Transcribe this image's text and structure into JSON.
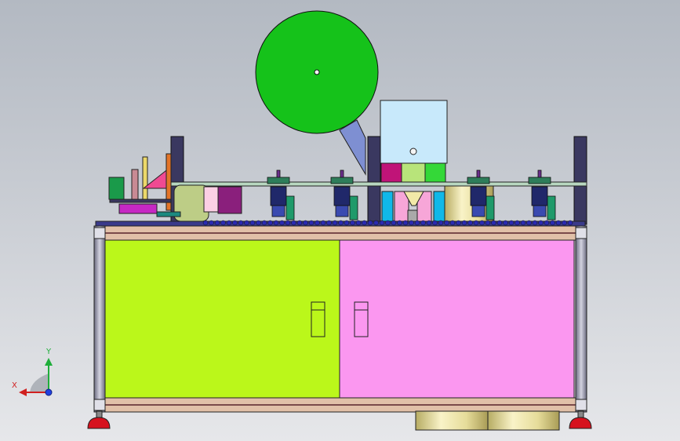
{
  "view": {
    "axis_triad": {
      "y_label": "Y",
      "x_label": "X"
    }
  },
  "colors": {
    "reel": "#15c21a",
    "left_door": "#bbf71a",
    "right_door": "#fb97f0",
    "frame": "#e1c0a8",
    "top_plate": "#b8d7c0",
    "motor_box": "#c8e9fb",
    "base_cylinder": "#efe7b0",
    "foot": "#d6121e"
  }
}
